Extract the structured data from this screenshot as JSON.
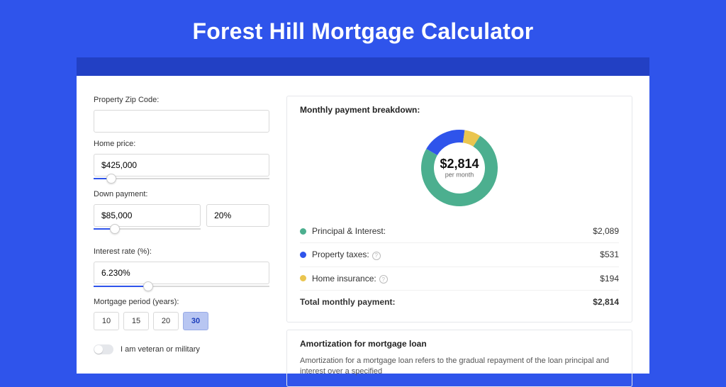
{
  "page_title": "Forest Hill Mortgage Calculator",
  "form": {
    "zip_label": "Property Zip Code:",
    "zip_value": "",
    "price_label": "Home price:",
    "price_value": "$425,000",
    "price_slider_pct": 10,
    "down_label": "Down payment:",
    "down_value": "$85,000",
    "down_pct": "20%",
    "down_slider_pct": 20,
    "rate_label": "Interest rate (%):",
    "rate_value": "6.230%",
    "rate_slider_pct": 31,
    "period_label": "Mortgage period (years):",
    "periods": [
      "10",
      "15",
      "20",
      "30"
    ],
    "period_selected": "30",
    "vet_label": "I am veteran or military",
    "vet_on": false
  },
  "breakdown": {
    "title": "Monthly payment breakdown:",
    "center_value": "$2,814",
    "center_sub": "per month",
    "items": [
      {
        "label": "Principal & Interest:",
        "value_text": "$2,089",
        "value": 2089,
        "color": "#4caf8f",
        "info": false
      },
      {
        "label": "Property taxes:",
        "value_text": "$531",
        "value": 531,
        "color": "#2f54eb",
        "info": true
      },
      {
        "label": "Home insurance:",
        "value_text": "$194",
        "value": 194,
        "color": "#eac54f",
        "info": true
      }
    ],
    "total_label": "Total monthly payment:",
    "total_value": "$2,814"
  },
  "amort": {
    "title": "Amortization for mortgage loan",
    "body": "Amortization for a mortgage loan refers to the gradual repayment of the loan principal and interest over a specified"
  },
  "chart_data": {
    "type": "pie",
    "title": "Monthly payment breakdown",
    "categories": [
      "Principal & Interest",
      "Property taxes",
      "Home insurance"
    ],
    "values": [
      2089,
      531,
      194
    ],
    "colors": [
      "#4caf8f",
      "#2f54eb",
      "#eac54f"
    ],
    "total": 2814,
    "total_label": "per month"
  }
}
